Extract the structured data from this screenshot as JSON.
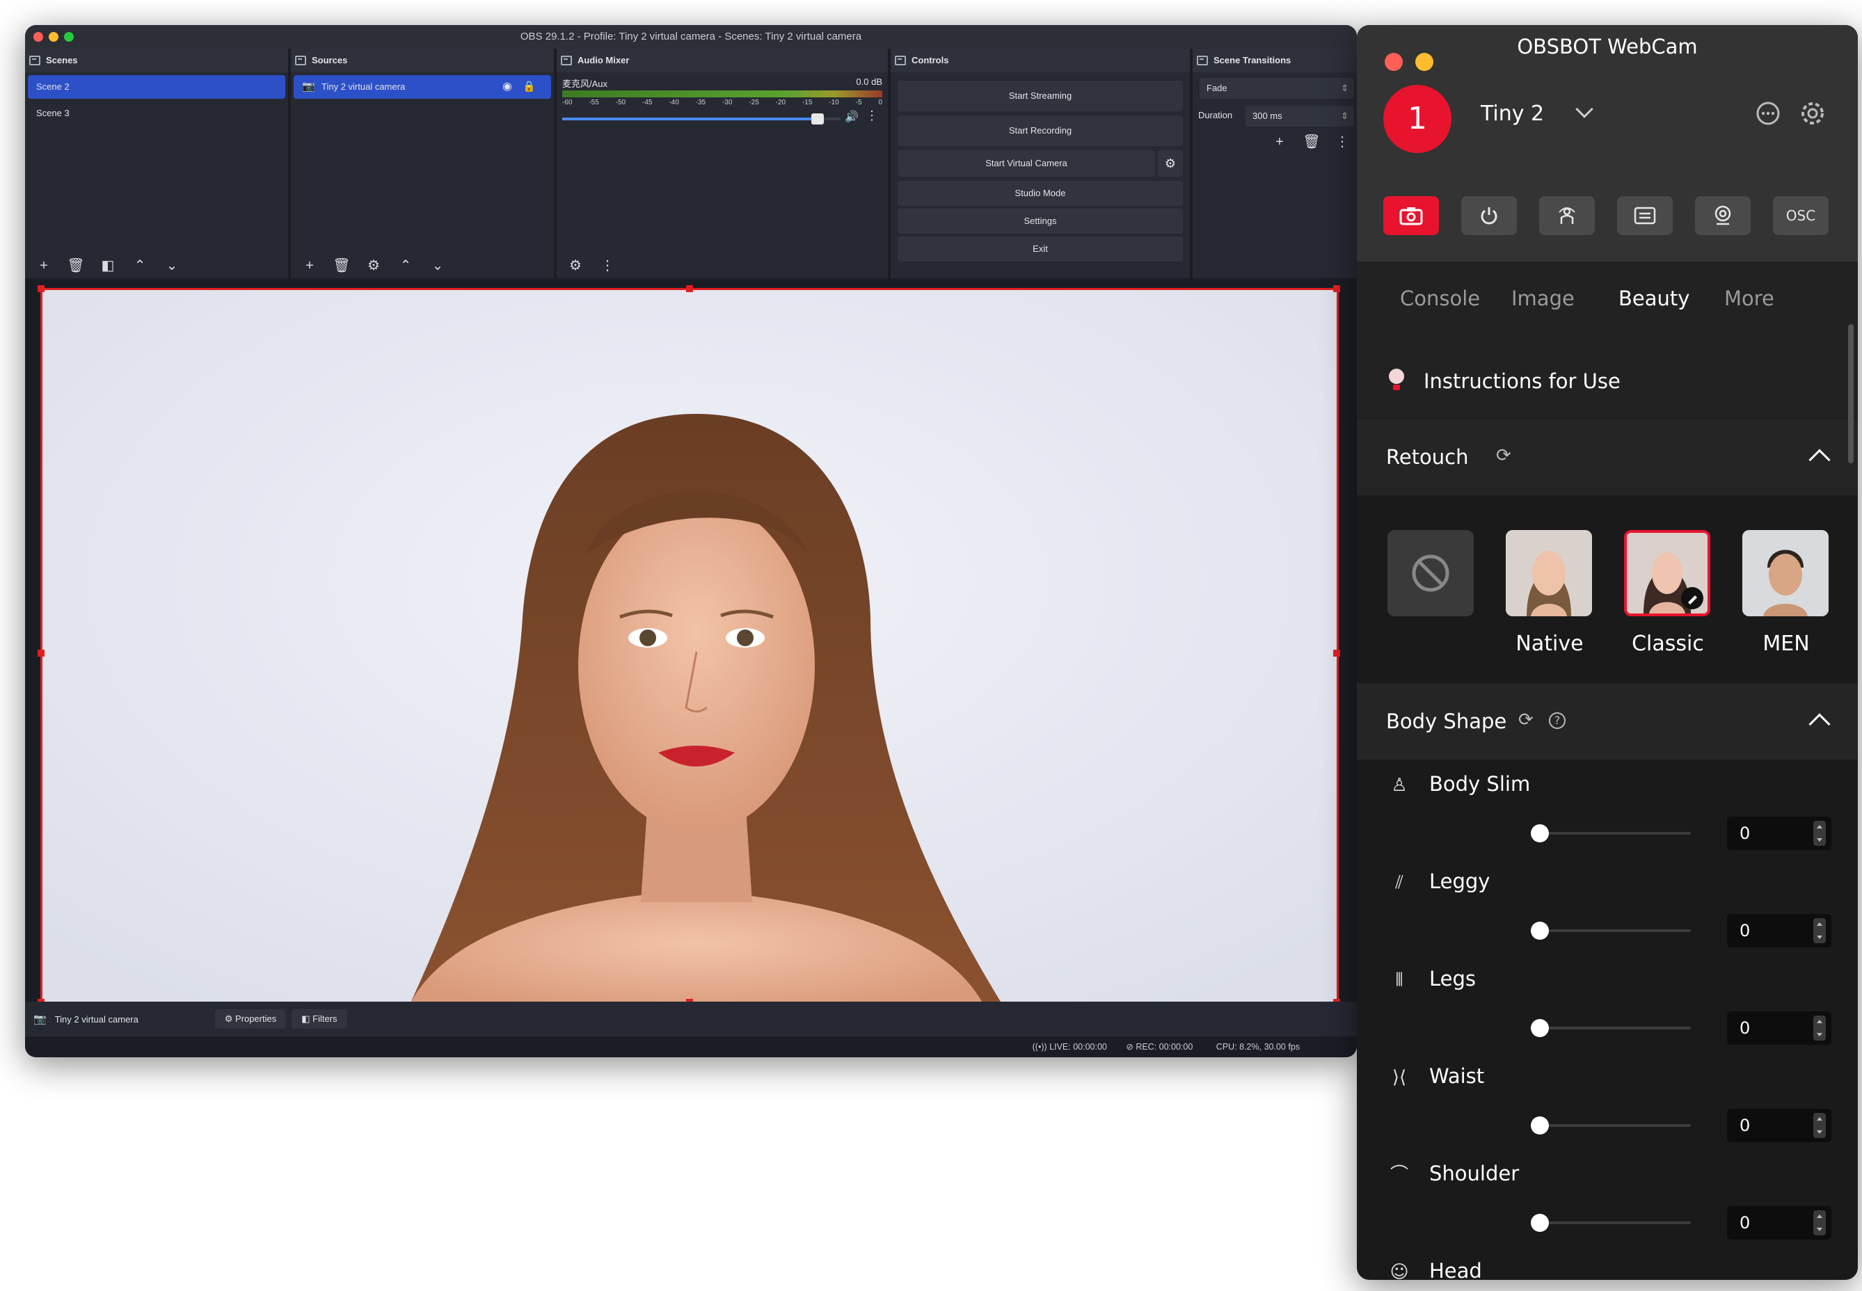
{
  "obs": {
    "title": "OBS 29.1.2 - Profile: Tiny 2 virtual camera - Scenes: Tiny 2 virtual camera",
    "scenes": {
      "header": "Scenes",
      "items": [
        "Scene 2",
        "Scene 3"
      ]
    },
    "sources": {
      "header": "Sources",
      "items": [
        "Tiny 2 virtual camera"
      ]
    },
    "audio_mixer": {
      "header": "Audio Mixer",
      "channel": "麦克风/Aux",
      "level": "0.0 dB",
      "ticks": [
        "-60",
        "-55",
        "-50",
        "-45",
        "-40",
        "-35",
        "-30",
        "-25",
        "-20",
        "-15",
        "-10",
        "-5",
        "0"
      ],
      "volume_fraction": 0.94
    },
    "controls": {
      "header": "Controls",
      "start_streaming": "Start Streaming",
      "start_recording": "Start Recording",
      "start_virtual_camera": "Start Virtual Camera",
      "studio_mode": "Studio Mode",
      "settings": "Settings",
      "exit": "Exit"
    },
    "transitions": {
      "header": "Scene Transitions",
      "selected": "Fade",
      "duration_label": "Duration",
      "duration_value": "300 ms"
    },
    "source_bar": {
      "source_name": "Tiny 2 virtual camera",
      "properties": "Properties",
      "filters": "Filters"
    },
    "status": {
      "live": "LIVE: 00:00:00",
      "rec": "REC: 00:00:00",
      "cpu": "CPU: 8.2%, 30.00 fps"
    }
  },
  "obsbot": {
    "title": "OBSBOT WebCam",
    "device_number": "1",
    "device_name": "Tiny 2",
    "mode_osc_label": "OSC",
    "tabs": [
      "Console",
      "Image",
      "Beauty",
      "More"
    ],
    "active_tab": "Beauty",
    "instructions": "Instructions for Use",
    "retouch": {
      "title": "Retouch",
      "presets": [
        "Native",
        "Classic",
        "MEN"
      ],
      "selected": "Classic"
    },
    "body_shape": {
      "title": "Body Shape",
      "sliders": [
        {
          "label": "Body Slim",
          "value": "0",
          "fraction": 0
        },
        {
          "label": "Leggy",
          "value": "0",
          "fraction": 0
        },
        {
          "label": "Legs",
          "value": "0",
          "fraction": 0
        },
        {
          "label": "Waist",
          "value": "0",
          "fraction": 0
        },
        {
          "label": "Shoulder",
          "value": "0",
          "fraction": 0
        },
        {
          "label": "Head",
          "value": "",
          "fraction": 0
        }
      ]
    }
  }
}
